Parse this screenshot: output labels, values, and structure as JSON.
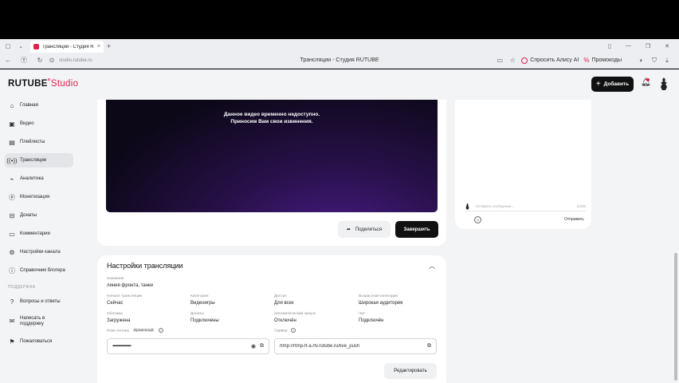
{
  "browser": {
    "tab_title": "Трансляции - Студия R",
    "url": "studio.rutube.ru",
    "page_title": "Трансляции - Студия RUTUBE",
    "alisa_label": "Спросить Алису AI",
    "promo_label": "Промокоды"
  },
  "header": {
    "logo_main": "RUTUBE",
    "logo_sub": "Studio",
    "add_label": "Добавить"
  },
  "sidebar": {
    "items": [
      {
        "label": "Главная",
        "icon": "home-icon"
      },
      {
        "label": "Видео",
        "icon": "video-icon"
      },
      {
        "label": "Плейлисты",
        "icon": "playlist-icon"
      },
      {
        "label": "Трансляции",
        "icon": "broadcast-icon",
        "active": true
      },
      {
        "label": "Аналитика",
        "icon": "analytics-icon"
      },
      {
        "label": "Монетизация",
        "icon": "monetization-icon"
      },
      {
        "label": "Донаты",
        "icon": "donate-icon"
      },
      {
        "label": "Комментарии",
        "icon": "comments-icon"
      },
      {
        "label": "Настройки канала",
        "icon": "settings-icon"
      },
      {
        "label": "Справочник блогера",
        "icon": "info-icon"
      }
    ],
    "support_title": "ПОДДЕРЖКА",
    "support_items": [
      {
        "label": "Вопросы и ответы",
        "icon": "question-icon"
      },
      {
        "label": "Написать в поддержку",
        "icon": "mail-icon"
      },
      {
        "label": "Пожаловаться",
        "icon": "flag-icon"
      }
    ]
  },
  "player": {
    "message_line1": "Данное видео временно недоступно.",
    "message_line2": "Приносим Вам свои извинения.",
    "share_label": "Поделиться",
    "finish_label": "Завершить"
  },
  "chat": {
    "placeholder": "Оставить сообщение...",
    "counter": "0/200",
    "send_label": "Отправить"
  },
  "settings": {
    "title": "Настройки трансляции",
    "name_label": "Название",
    "name_value": "линия фронта, танки",
    "start_label": "Начало трансляции",
    "start_value": "Сейчас",
    "category_label": "Категория",
    "category_value": "Видеоигры",
    "access_label": "Доступ",
    "access_value": "Для всех",
    "age_label": "Возрастная категория",
    "age_value": "Широкая аудитория",
    "cover_label": "Обложка",
    "cover_value": "Загружена",
    "donates_label": "Донаты",
    "donates_value": "Подключены",
    "autostart_label": "Автоматический запуск",
    "autostart_value": "Отключён",
    "chat_label": "Чат",
    "chat_value": "Подключён",
    "key_label": "Ключ потока",
    "key_badge": "Временный",
    "key_value": "••••••••••••••••••••••••••••••••••••••••••••••••••••••••••••••••",
    "server_label": "Сервер",
    "server_value": "rtmp://rtmp-ft-a.rtv.rutube.ru/live_push",
    "edit_label": "Редактировать"
  }
}
